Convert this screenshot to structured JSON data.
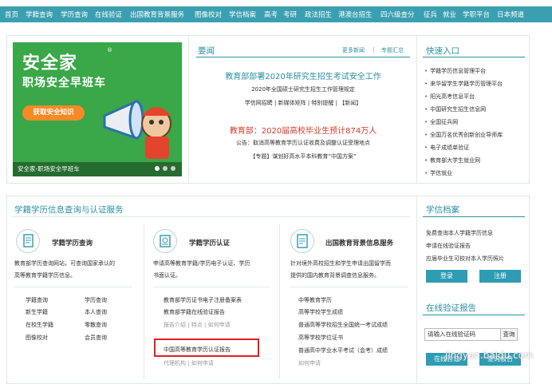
{
  "nav": [
    "首页",
    "学籍查询",
    "学历查询",
    "在线验证",
    "出国教育背景服务",
    "图像校对",
    "学信档案",
    "高考",
    "考研",
    "政法招生",
    "港澳台招生",
    "四六级查分",
    "征兵",
    "就业",
    "学职平台",
    "日本频道"
  ],
  "banner": {
    "logo": "安全家",
    "reg": "®",
    "slogan": "职场安全早班车",
    "button": "获取安全知识",
    "caption": "安全家-职场安全早班车"
  },
  "news": {
    "title": "要闻",
    "more": "更多新闻",
    "sep": "|",
    "topics": "专题汇总",
    "headline1": "教育部部署2020年研究生招生考试安全工作",
    "sub1": "2020年全国硕士研究生招生工作管理规定",
    "sub1b": "学信网招聘 | 新媒体矩阵 | 特别提醒 | 【新闻】",
    "headline2": "教育部：2020届高校毕业生预计874万人",
    "sub2": "公告：取消高等教育学历认证收费及调整认证受理地点",
    "sub2b": "【专题】谋划好高水平本科教育“中国方案”"
  },
  "quick": {
    "title": "快速入口",
    "items": [
      "学籍学历信息管理平台",
      "来华留学生学籍学历管理平台",
      "阳光高考信息平台",
      "中国研究生招生信息网",
      "全国征兵网",
      "全国万名优秀创新创业导师库",
      "电子成绩单验证",
      "教育部大学生就业网",
      "学信就业"
    ]
  },
  "services": {
    "title": "学籍学历信息查询与认证服务",
    "card1": {
      "title": "学籍学历查询",
      "desc1": "教育部学历查询网站，可查询国家承认的",
      "desc2": "高等教育学籍学历信息。",
      "links": [
        "学籍查询",
        "学历查询",
        "新生学籍",
        "本人查询",
        "在校生学籍",
        "零散查询",
        "图像校对",
        "会员查询"
      ]
    },
    "card2": {
      "title": "学籍学历认证",
      "desc1": "申请高等教育学籍/学历电子认证、学历",
      "desc2": "书面认证。",
      "link1": "教育部学历证书电子注册备案表",
      "link2": "教育部学籍在线验证报告",
      "sub1": "报告介绍  |  特点  |  如何申请",
      "link3": "中国高等教育学历认证报告",
      "sub2": "代理机构  |  如何申请"
    },
    "card3": {
      "title": "出国教育背景信息服务",
      "desc1": "针对境外高校招生和学生申请出国留学而",
      "desc2": "提供的国内教育背景调查信息服务。",
      "links": [
        "中等教育学历",
        "高等学校学生成绩",
        "普通高等学校招生全国统一考试成绩",
        "高等学校学位证书",
        "普通高中学业水平考试（会考）成绩"
      ],
      "sub": "如何申请"
    }
  },
  "archive": {
    "title": "学信档案",
    "lines": [
      "免费查询本人学籍学历信息",
      "申请在线验证报告",
      "应届毕业生可校对本人学历照片"
    ],
    "login": "登录",
    "register": "注册"
  },
  "verify": {
    "title": "在线验证报告",
    "placeholder": "请输入在线验证码",
    "go": "查询",
    "btn1": "在线验证",
    "btn2": "查询报告"
  },
  "watermark": "jingyan.baidu.com"
}
